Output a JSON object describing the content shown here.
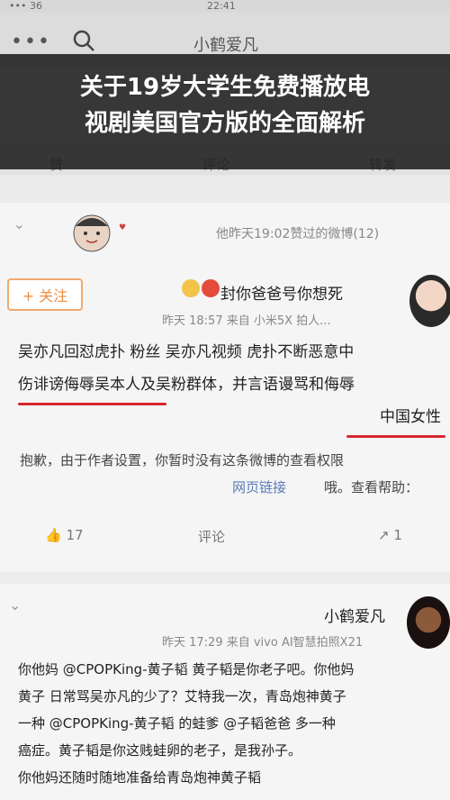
{
  "status_bar": {
    "left": "••• 36",
    "center": "22:41",
    "right": ""
  },
  "header": {
    "menu_dots": "•••",
    "title": "小鹤爱凡"
  },
  "banner": {
    "line1": "关于19岁大学生免费播放电",
    "line2": "视剧美国官方版的全面解析"
  },
  "top_actions": {
    "like": "赞",
    "comment": "评论",
    "share": "转发"
  },
  "post1": {
    "liked_note": "他昨天19:02赞过的微博(12)",
    "follow_label": "+ 关注",
    "user_name": "封你爸爸号你想死",
    "meta": "昨天 18:57 来自 小米5X 拍人...",
    "text_lines": [
      "吴亦凡回怼虎扑 粉丝 吴亦凡视频 虎扑不断恶意中",
      "伤诽谤侮辱吴本人及吴粉群体，并言语谩骂和侮辱",
      "中国女性"
    ],
    "notice_lines": [
      "抱歉，由于作者设置，你暂时没有这条微博的查看权限",
      "哦。查看帮助：",
      "网页链接"
    ],
    "actions": {
      "share": "1",
      "comment": "评论",
      "like": "17"
    }
  },
  "post2": {
    "user_name": "小鹤爱凡",
    "meta": "昨天 17:29 来自 vivo AI智慧拍照X21",
    "text_lines": [
      "你他妈 @CPOPKing-黄子韬 黄子韬是你老子吧。你他妈",
      "黄子 日常骂吴亦凡的少了？艾特我一次，青岛炮神黄子",
      "一种 @CPOPKing-黄子韬 的蛙爹 @子韬爸爸 多一种",
      "癌症。黄子韬是你这贱蛙卵的老子，是我孙子。",
      "你他妈还随时随地准备给青岛炮神黄子韬"
    ]
  },
  "colors": {
    "accent": "#f08e3e",
    "link": "#5b7bb8",
    "highlight": "#d8262d"
  }
}
